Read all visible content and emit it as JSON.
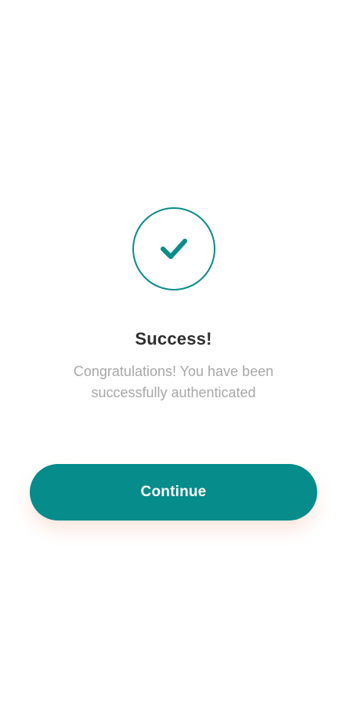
{
  "status": {
    "icon": "check-icon",
    "title": "Success!",
    "message": "Congratulations! You have been successfully authenticated"
  },
  "actions": {
    "continue_label": "Continue"
  },
  "colors": {
    "accent": "#068c8a",
    "title": "#2e2e2e",
    "message": "#a8a8a8",
    "background": "#ffffff"
  }
}
